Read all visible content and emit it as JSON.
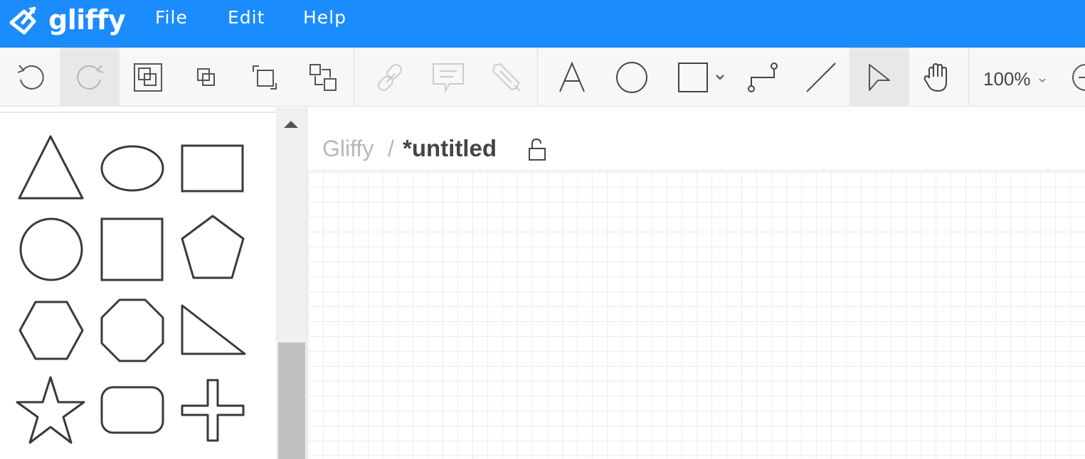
{
  "app": {
    "logo_text": "gliffy",
    "brand_color": "#1a8cfe"
  },
  "menu": {
    "items": [
      {
        "label": "File"
      },
      {
        "label": "Edit"
      },
      {
        "label": "Help"
      }
    ]
  },
  "toolbar": {
    "buttons": [
      {
        "icon": "undo-icon",
        "enabled": true
      },
      {
        "icon": "redo-icon",
        "enabled": false
      },
      {
        "icon": "group-icon",
        "enabled": true
      },
      {
        "icon": "bring-forward-icon",
        "enabled": true
      },
      {
        "icon": "send-backward-icon",
        "enabled": true
      },
      {
        "icon": "arrange-icon",
        "enabled": true
      },
      {
        "icon": "link-icon",
        "enabled": false
      },
      {
        "icon": "comment-icon",
        "enabled": false
      },
      {
        "icon": "eyedropper-icon",
        "enabled": false
      },
      {
        "icon": "text-tool-icon",
        "enabled": true
      },
      {
        "icon": "ellipse-tool-icon",
        "enabled": true
      },
      {
        "icon": "rectangle-tool-icon",
        "enabled": true
      },
      {
        "icon": "connector-tool-icon",
        "enabled": true
      },
      {
        "icon": "line-tool-icon",
        "enabled": true
      },
      {
        "icon": "pointer-tool-icon",
        "enabled": true,
        "active": true
      },
      {
        "icon": "pan-tool-icon",
        "enabled": true
      }
    ],
    "zoom_label": "100%"
  },
  "shape_panel": {
    "shapes": [
      "triangle",
      "ellipse",
      "rectangle",
      "circle",
      "square",
      "pentagon",
      "hexagon",
      "octagon",
      "right-triangle",
      "star",
      "rounded-rectangle",
      "cross"
    ]
  },
  "document": {
    "breadcrumb_root": "Gliffy",
    "breadcrumb_separator": "/",
    "title": "*untitled"
  }
}
